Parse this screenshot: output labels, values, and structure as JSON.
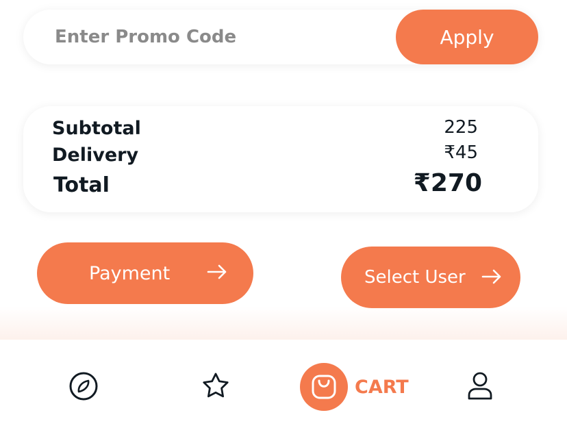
{
  "promo": {
    "placeholder": "Enter Promo Code",
    "apply_label": "Apply"
  },
  "summary": {
    "subtotal_label": "Subtotal",
    "subtotal_value": "225",
    "delivery_label": "Delivery",
    "delivery_value": "₹45",
    "total_label": "Total",
    "total_value": "₹270"
  },
  "actions": {
    "payment_label": "Payment",
    "select_user_label": "Select User"
  },
  "bottom_nav": {
    "items": [
      {
        "icon": "compass-icon",
        "label": ""
      },
      {
        "icon": "star-icon",
        "label": ""
      },
      {
        "icon": "shopping-bag-icon",
        "label": "CART",
        "active": true
      },
      {
        "icon": "user-icon",
        "label": ""
      }
    ]
  },
  "colors": {
    "accent": "#f47a4d",
    "text": "#111a22",
    "placeholder": "#8a8a8a"
  }
}
